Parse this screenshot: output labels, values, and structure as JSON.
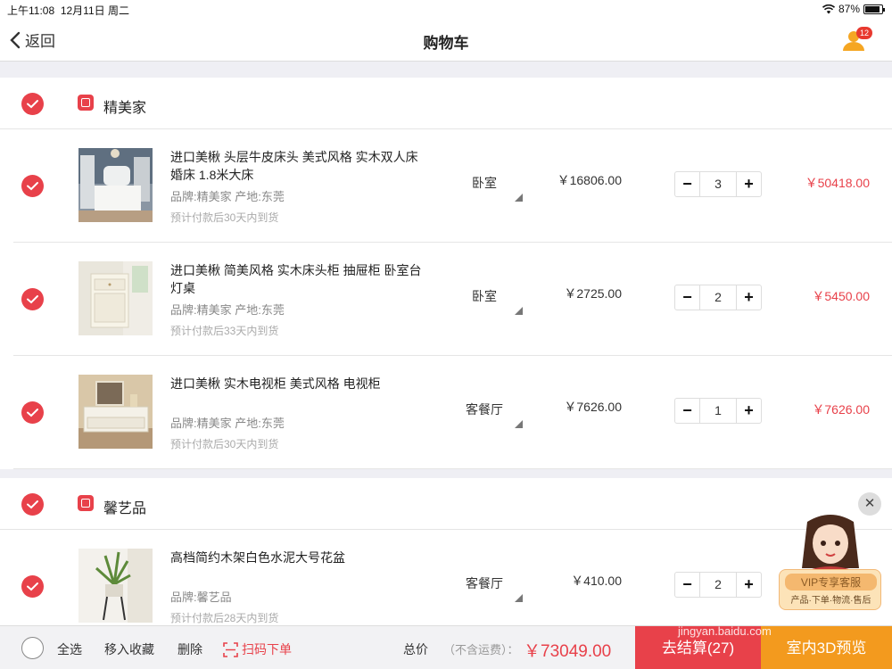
{
  "status": {
    "time": "上午11:08",
    "date": "12月11日 周二",
    "battery": "87%",
    "battery_level": 0.87
  },
  "nav": {
    "back_label": "返回",
    "title": "购物车",
    "badge": "12"
  },
  "shops": [
    {
      "name": "精美家",
      "items": [
        {
          "title": "进口美楸 头层牛皮床头 美式风格 实木双人床 婚床 1.8米大床",
          "brand": "品牌:精美家 产地:东莞",
          "ship": "预计付款后30天内到货",
          "room": "卧室",
          "price": "￥16806.00",
          "qty": "3",
          "subtotal": "￥50418.00"
        },
        {
          "title": "进口美楸  简美风格 实木床头柜 抽屉柜 卧室台灯桌",
          "brand": "品牌:精美家 产地:东莞",
          "ship": "预计付款后33天内到货",
          "room": "卧室",
          "price": "￥2725.00",
          "qty": "2",
          "subtotal": "￥5450.00"
        },
        {
          "title": "进口美楸 实木电视柜 美式风格 电视柜",
          "brand": "品牌:精美家 产地:东莞",
          "ship": "预计付款后30天内到货",
          "room": "客餐厅",
          "price": "￥7626.00",
          "qty": "1",
          "subtotal": "￥7626.00"
        }
      ]
    },
    {
      "name": "馨艺品",
      "items": [
        {
          "title": "高档简约木架白色水泥大号花盆",
          "brand": "品牌:馨艺品",
          "ship": "预计付款后28天内到货",
          "room": "客餐厅",
          "price": "￥410.00",
          "qty": "2",
          "subtotal": ""
        }
      ]
    }
  ],
  "stepper": {
    "minus": "−",
    "plus": "+"
  },
  "bottom": {
    "select_all": "全选",
    "move_fav": "移入收藏",
    "delete": "删除",
    "scan": "扫码下单",
    "total_label": "总价",
    "freight_note": "（不含运费）：",
    "total": "￥73049.00",
    "checkout": "去结算(27)",
    "preview": "室内3D预览"
  },
  "vip": {
    "title": "VIP专享客服",
    "subtitle": "产品·下单·物流·售后",
    "close": "✕"
  },
  "watermark": "jingyan.baidu.com",
  "colors": {
    "accent": "#e8414a",
    "orange": "#f39a1e"
  }
}
